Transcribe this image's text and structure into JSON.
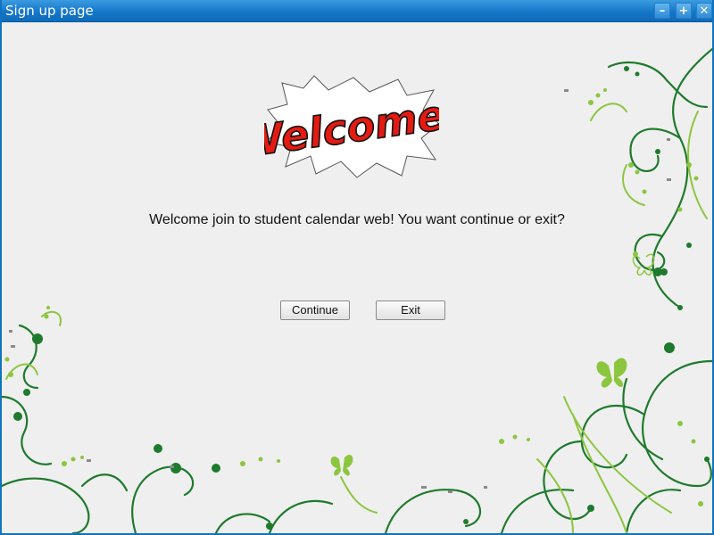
{
  "window": {
    "title": "Sign up page",
    "controls": {
      "minimize_icon": "minimize-icon",
      "maximize_icon": "maximize-icon",
      "close_icon": "close-icon"
    }
  },
  "banner": {
    "text": "Welcome!",
    "text_color": "#e31b12",
    "burst_color": "#ffffff"
  },
  "main": {
    "message": "Welcome join to student calendar web! You want continue or exit?",
    "continue_label": "Continue",
    "exit_label": "Exit"
  },
  "theme": {
    "titlebar_color": "#1577c8",
    "background": "#efefef",
    "vine_dark": "#1e7a2c",
    "vine_light": "#8cc63f"
  }
}
